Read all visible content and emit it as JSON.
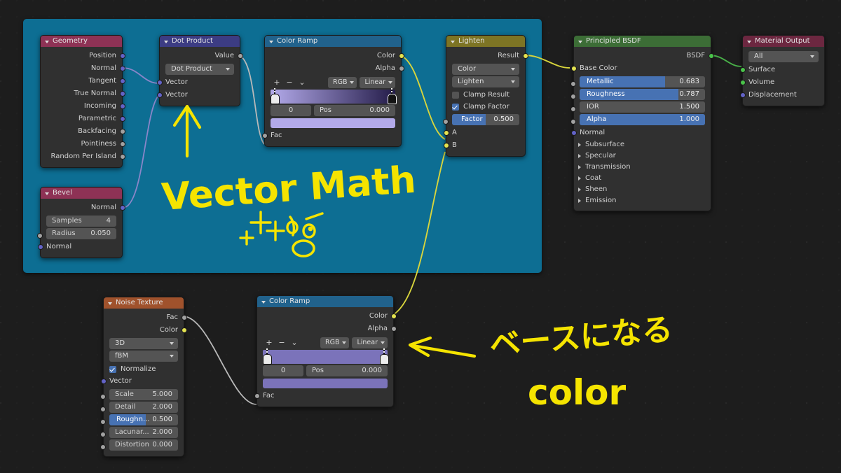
{
  "editor": {
    "background_color": "#1d1d1d",
    "frame_color": "#0d6e93"
  },
  "nodes": {
    "geometry": {
      "title": "Geometry",
      "header_color": "#8e3255",
      "outputs": [
        {
          "label": "Position",
          "socket": "vector"
        },
        {
          "label": "Normal",
          "socket": "vector"
        },
        {
          "label": "Tangent",
          "socket": "vector"
        },
        {
          "label": "True Normal",
          "socket": "vector"
        },
        {
          "label": "Incoming",
          "socket": "vector"
        },
        {
          "label": "Parametric",
          "socket": "vector"
        },
        {
          "label": "Backfacing",
          "socket": "gray"
        },
        {
          "label": "Pointiness",
          "socket": "gray"
        },
        {
          "label": "Random Per Island",
          "socket": "gray"
        }
      ]
    },
    "bevel": {
      "title": "Bevel",
      "header_color": "#8e3255",
      "outputs": [
        {
          "label": "Normal",
          "socket": "vector"
        }
      ],
      "samples": {
        "label": "Samples",
        "value": "4"
      },
      "radius": {
        "label": "Radius",
        "value": "0.050"
      },
      "normal_input": {
        "label": "Normal",
        "socket": "vector"
      }
    },
    "dot_product": {
      "title": "Dot Product",
      "header_color": "#3c3c83",
      "outputs": [
        {
          "label": "Value",
          "socket": "gray"
        }
      ],
      "operation": "Dot Product",
      "inputs": [
        {
          "label": "Vector",
          "socket": "vector"
        },
        {
          "label": "Vector",
          "socket": "vector"
        }
      ]
    },
    "color_ramp_top": {
      "title": "Color Ramp",
      "header_color": "#21628c",
      "outputs": [
        {
          "label": "Color",
          "socket": "yellow"
        },
        {
          "label": "Alpha",
          "socket": "gray"
        }
      ],
      "tools": {
        "add": "+",
        "remove": "−",
        "menu": "⌄"
      },
      "color_mode": "RGB",
      "interpolation": "Linear",
      "gradient_from": "#b3aaea",
      "gradient_to": "#241c49",
      "index": "0",
      "pos_label": "Pos",
      "pos_value": "0.000",
      "swatch_color": "#b3aaea",
      "inputs": [
        {
          "label": "Fac",
          "socket": "gray"
        }
      ]
    },
    "lighten": {
      "title": "Lighten",
      "header_color": "#7d7424",
      "outputs": [
        {
          "label": "Result",
          "socket": "yellow"
        }
      ],
      "data_type": "Color",
      "blend_mode": "Lighten",
      "clamp_result": {
        "label": "Clamp Result",
        "checked": false
      },
      "clamp_factor": {
        "label": "Clamp Factor",
        "checked": true
      },
      "factor": {
        "label": "Factor",
        "value": "0.500",
        "fill_percent": 50,
        "socket": "gray"
      },
      "inputs": [
        {
          "label": "A",
          "socket": "yellow"
        },
        {
          "label": "B",
          "socket": "yellow"
        }
      ]
    },
    "principled_bsdf": {
      "title": "Principled BSDF",
      "header_color": "#3c6d36",
      "outputs": [
        {
          "label": "BSDF",
          "socket": "green"
        }
      ],
      "base_color": {
        "label": "Base Color",
        "socket": "yellow"
      },
      "sliders": [
        {
          "label": "Metallic",
          "value": "0.683",
          "fill_percent": 68.3,
          "filled": true
        },
        {
          "label": "Roughness",
          "value": "0.787",
          "fill_percent": 78.7,
          "filled": true
        },
        {
          "label": "IOR",
          "value": "1.500",
          "fill_percent": 0,
          "filled": false
        },
        {
          "label": "Alpha",
          "value": "1.000",
          "fill_percent": 100,
          "filled": true
        }
      ],
      "normal": {
        "label": "Normal",
        "socket": "vector"
      },
      "panels": [
        "Subsurface",
        "Specular",
        "Transmission",
        "Coat",
        "Sheen",
        "Emission"
      ]
    },
    "material_output": {
      "title": "Material Output",
      "header_color": "#6c2740",
      "target": "All",
      "inputs": [
        {
          "label": "Surface",
          "socket": "green"
        },
        {
          "label": "Volume",
          "socket": "green"
        },
        {
          "label": "Displacement",
          "socket": "vector"
        }
      ]
    },
    "noise_texture": {
      "title": "Noise Texture",
      "header_color": "#a0522c",
      "outputs": [
        {
          "label": "Fac",
          "socket": "gray"
        },
        {
          "label": "Color",
          "socket": "yellow"
        }
      ],
      "dimensions": "3D",
      "noise_type": "fBM",
      "normalize": {
        "label": "Normalize",
        "checked": true
      },
      "vector_input": {
        "label": "Vector",
        "socket": "vector"
      },
      "values": [
        {
          "label": "Scale",
          "value": "5.000",
          "highlight": false
        },
        {
          "label": "Detail",
          "value": "2.000",
          "highlight": false
        },
        {
          "label": "Roughn...",
          "value": "0.500",
          "highlight": true
        },
        {
          "label": "Lacunar...",
          "value": "2.000",
          "highlight": false
        },
        {
          "label": "Distortion",
          "value": "0.000",
          "highlight": false
        }
      ]
    },
    "color_ramp_bottom": {
      "title": "Color Ramp",
      "header_color": "#21628c",
      "outputs": [
        {
          "label": "Color",
          "socket": "yellow"
        },
        {
          "label": "Alpha",
          "socket": "gray"
        }
      ],
      "tools": {
        "add": "+",
        "remove": "−",
        "menu": "⌄"
      },
      "color_mode": "RGB",
      "interpolation": "Linear",
      "gradient_from": "#7b73ba",
      "gradient_to": "#7b73ba",
      "index": "0",
      "pos_label": "Pos",
      "pos_value": "0.000",
      "swatch_color": "#7b73ba",
      "inputs": [
        {
          "label": "Fac",
          "socket": "gray"
        }
      ]
    }
  },
  "annotations": {
    "vector_math": "Vector Math",
    "base_color_jp": "ベースになる",
    "base_color_en": "color",
    "ink_color": "#f5e400"
  }
}
